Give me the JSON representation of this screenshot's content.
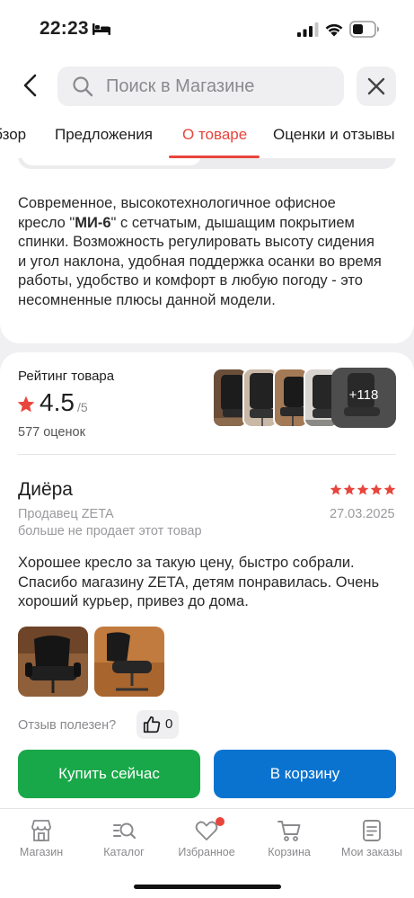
{
  "status_bar": {
    "time": "22:23"
  },
  "search": {
    "placeholder": "Поиск в Магазине"
  },
  "tabs": [
    {
      "label": "Обзор"
    },
    {
      "label": "Предложения"
    },
    {
      "label": "О товаре"
    },
    {
      "label": "Оценки и отзывы"
    }
  ],
  "description": {
    "before": "Современное, высокотехнологичное офисное кресло \"",
    "model": "МИ-6",
    "after": "\" с сетчатым, дышащим покрытием спинки. Возможность регулировать высоту сидения и угол наклона, удобная поддержка осанки во время работы, удобство и комфорт в любую погоду - это несомненные плюсы данной модели."
  },
  "rating": {
    "title": "Рейтинг товара",
    "value": "4.5",
    "max": "/5",
    "count": "577 оценок",
    "more_photos": "+118"
  },
  "review": {
    "author": "Диёра",
    "stars": 5,
    "seller": "Продавец ZETA",
    "date": "27.03.2025",
    "seller_note": "больше не продает этот товар",
    "text": "Хорошее кресло за такую цену, быстро собрали. Спасибо магазину ZETA, детям понравилась. Очень хороший курьер, привез до дома.",
    "helpful_label": "Отзыв полезен?",
    "likes": "0"
  },
  "actions": {
    "buy_now": "Купить сейчас",
    "add_to_cart": "В корзину"
  },
  "bottom_nav": {
    "items": [
      {
        "label": "Магазин",
        "icon": "store-icon"
      },
      {
        "label": "Каталог",
        "icon": "catalog-search-icon"
      },
      {
        "label": "Избранное",
        "icon": "heart-icon"
      },
      {
        "label": "Корзина",
        "icon": "cart-icon"
      },
      {
        "label": "Мои заказы",
        "icon": "orders-icon"
      }
    ]
  },
  "colors": {
    "accent": "#e8453c",
    "buy_green": "#19a849",
    "cart_blue": "#0a73cf"
  }
}
